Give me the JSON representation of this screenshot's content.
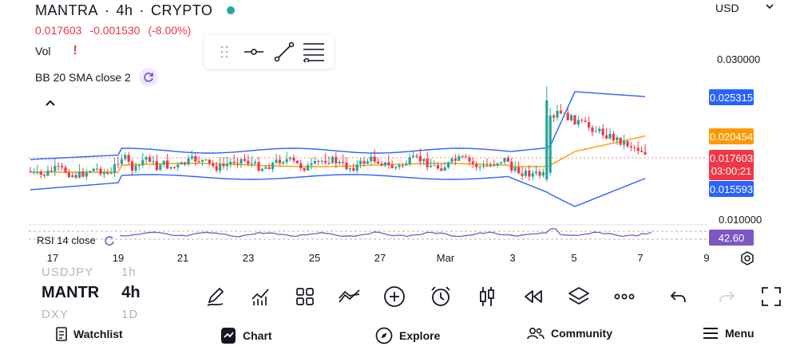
{
  "header": {
    "symbol": "MANTRA",
    "interval": "4h",
    "exchange": "CRYPTO",
    "separator": "·",
    "last_price": "0.017603",
    "change": "-0.001530",
    "change_pct": "(-8.00%)",
    "currency": "USD",
    "status_color": "#26a69a"
  },
  "indicators": {
    "vol_label": "Vol",
    "vol_warning": "!",
    "bb_label": "BB 20 SMA close 2",
    "rsi_label": "RSI 14 close"
  },
  "price_axis": {
    "ticks": [
      "0.030000",
      "0.010000"
    ],
    "upper_band_tag": "0.025315",
    "sma_tag": "0.020454",
    "last_price_tag": "0.017603",
    "countdown": "03:00:21",
    "lower_band_tag": "0.015593",
    "rsi_value_tag": "42.60"
  },
  "time_axis": [
    "17",
    "19",
    "21",
    "23",
    "25",
    "27",
    "Mar",
    "3",
    "5",
    "7",
    "9"
  ],
  "colors": {
    "up": "#26a69a",
    "down": "#f23645",
    "band": "#2962ff",
    "sma": "#ff9800",
    "rsi": "#7e57c2"
  },
  "bottom_bar": {
    "symbol_short": "MANTR",
    "interval": "4h",
    "ghost_symbol_above": "USDJPY",
    "ghost_interval_above": "1h",
    "ghost_symbol_below": "DXY",
    "ghost_interval_below": "1D",
    "tools": [
      "pencil-icon",
      "indicators-icon",
      "grid-icon",
      "compare-icon",
      "add-icon",
      "alarm-icon",
      "candles-icon",
      "replay-icon",
      "layers-icon",
      "more-icon",
      "undo-icon",
      "redo-icon",
      "fullscreen-icon"
    ]
  },
  "nav": {
    "watchlist": "Watchlist",
    "chart": "Chart",
    "explore": "Explore",
    "community": "Community",
    "menu": "Menu"
  }
}
